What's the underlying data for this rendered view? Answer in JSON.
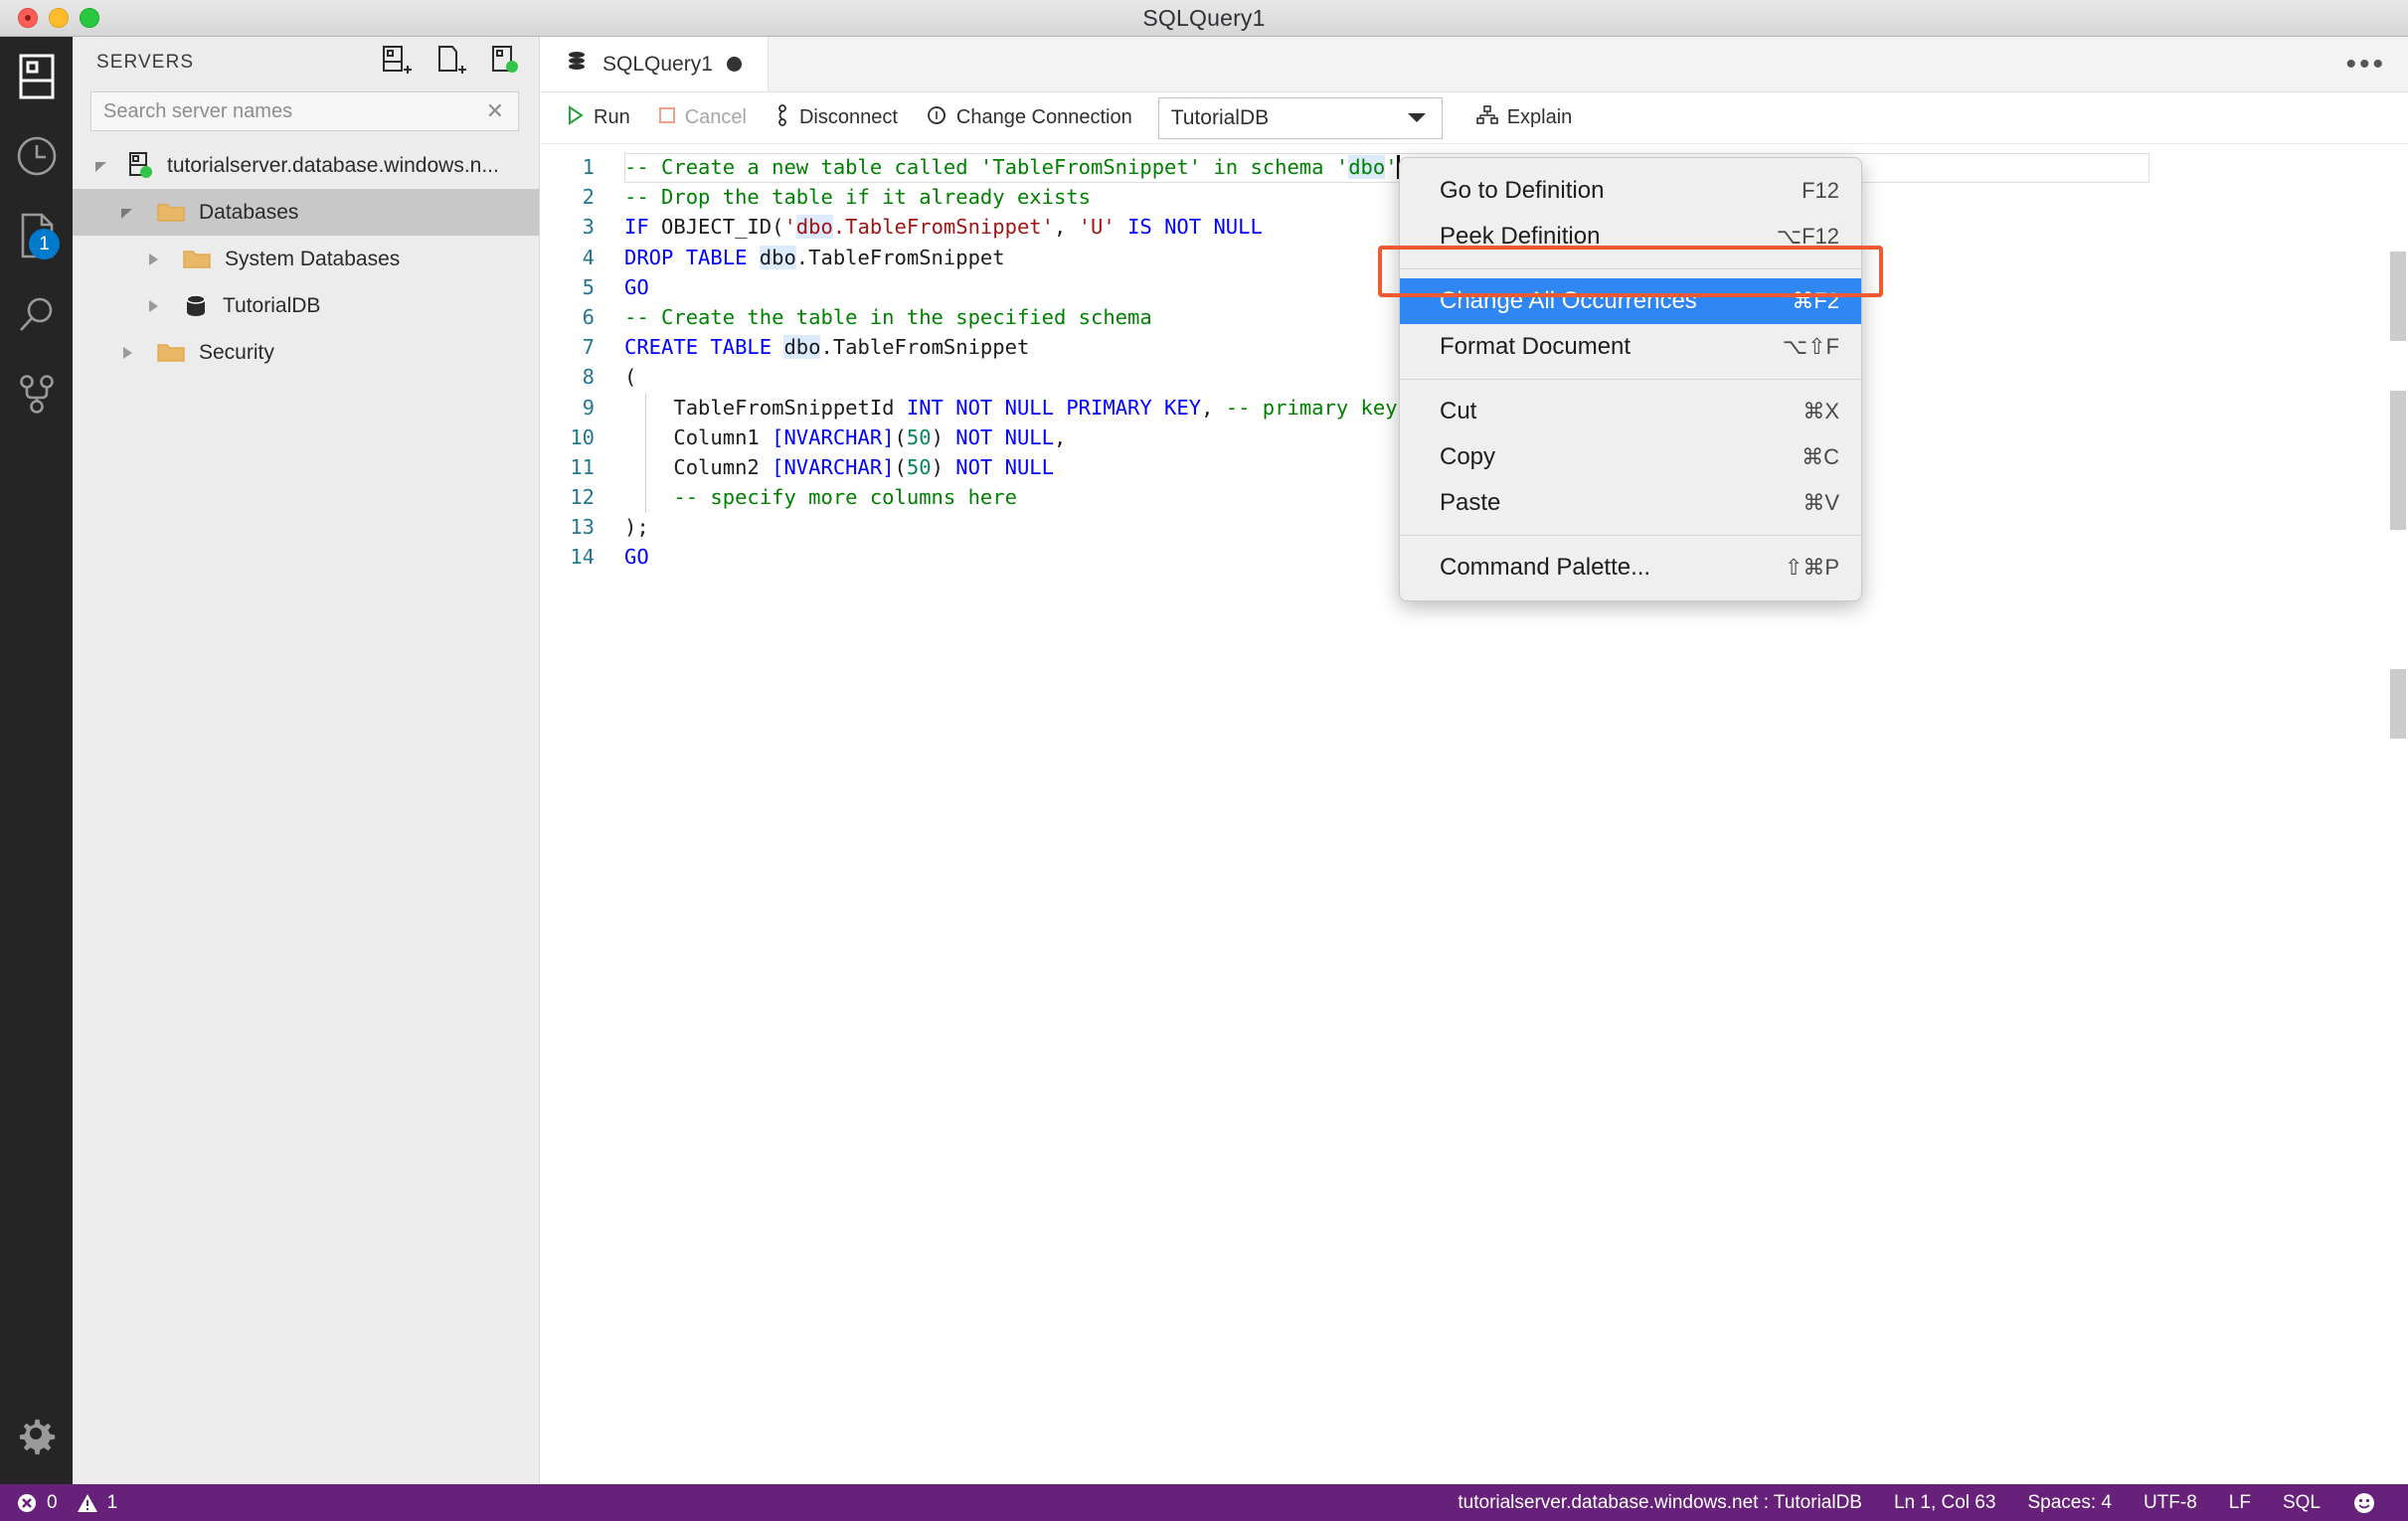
{
  "window": {
    "title": "SQLQuery1",
    "traffic_lights": [
      "close-button",
      "minimize-button",
      "zoom-button"
    ]
  },
  "activity_bar": {
    "items": [
      {
        "name": "servers-icon",
        "label": "Servers"
      },
      {
        "name": "history-icon",
        "label": "Query History"
      },
      {
        "name": "file-icon",
        "label": "Explorer",
        "badge": "1"
      },
      {
        "name": "search-icon",
        "label": "Search"
      },
      {
        "name": "source-control-icon",
        "label": "Source Control"
      }
    ],
    "bottom": {
      "name": "gear-icon",
      "label": "Manage"
    }
  },
  "sidebar": {
    "title": "SERVERS",
    "actions": [
      {
        "name": "new-connection-icon",
        "label": "New Connection"
      },
      {
        "name": "new-query-icon",
        "label": "New Query"
      },
      {
        "name": "new-server-group-icon",
        "label": "New Server Group"
      }
    ],
    "search": {
      "placeholder": "Search server names",
      "value": "",
      "clear_label": "✕"
    },
    "tree": [
      {
        "label": "tutorialserver.database.windows.n...",
        "icon": "server-icon",
        "indent": 0,
        "expanded": true,
        "selected": false
      },
      {
        "label": "Databases",
        "icon": "folder-icon",
        "indent": 1,
        "expanded": true,
        "selected": true
      },
      {
        "label": "System Databases",
        "icon": "folder-icon",
        "indent": 2,
        "expanded": false,
        "selected": false
      },
      {
        "label": "TutorialDB",
        "icon": "database-icon",
        "indent": 2,
        "expanded": false,
        "selected": false
      },
      {
        "label": "Security",
        "icon": "folder-icon",
        "indent": 1,
        "expanded": false,
        "selected": false
      }
    ]
  },
  "editor": {
    "tab": {
      "label": "SQLQuery1",
      "icon": "database-icon",
      "dirty": true
    },
    "overflow_label": "•••",
    "toolbar": {
      "run": "Run",
      "cancel": "Cancel",
      "disconnect": "Disconnect",
      "change_connection": "Change Connection",
      "database_select": "TutorialDB",
      "explain": "Explain"
    },
    "lines": [
      {
        "n": "1",
        "tokens": [
          {
            "t": "-- Create a new table called 'TableFromSnippet' in schema '",
            "c": "cmt"
          },
          {
            "t": "dbo",
            "c": "cmt hl"
          },
          {
            "t": "'",
            "c": "cmt"
          }
        ],
        "caret_after": true,
        "current": true
      },
      {
        "n": "2",
        "tokens": [
          {
            "t": "-- Drop the table if it already exists",
            "c": "cmt"
          }
        ]
      },
      {
        "n": "3",
        "tokens": [
          {
            "t": "IF",
            "c": "kw"
          },
          {
            "t": " OBJECT_ID(",
            "c": "plain"
          },
          {
            "t": "'",
            "c": "str"
          },
          {
            "t": "dbo",
            "c": "str hl"
          },
          {
            "t": ".TableFromSnippet'",
            "c": "str"
          },
          {
            "t": ", ",
            "c": "plain"
          },
          {
            "t": "'U'",
            "c": "str"
          },
          {
            "t": " ",
            "c": "plain"
          },
          {
            "t": "IS NOT NULL",
            "c": "kw"
          }
        ]
      },
      {
        "n": "4",
        "tokens": [
          {
            "t": "DROP TABLE",
            "c": "kw"
          },
          {
            "t": " ",
            "c": "plain"
          },
          {
            "t": "dbo",
            "c": "plain hl"
          },
          {
            "t": ".TableFromSnippet",
            "c": "plain"
          }
        ]
      },
      {
        "n": "5",
        "tokens": [
          {
            "t": "GO",
            "c": "kw"
          }
        ]
      },
      {
        "n": "6",
        "tokens": [
          {
            "t": "-- Create the table in the specified schema",
            "c": "cmt"
          }
        ]
      },
      {
        "n": "7",
        "tokens": [
          {
            "t": "CREATE TABLE",
            "c": "kw"
          },
          {
            "t": " ",
            "c": "plain"
          },
          {
            "t": "dbo",
            "c": "plain hl"
          },
          {
            "t": ".TableFromSnippet",
            "c": "plain"
          }
        ]
      },
      {
        "n": "8",
        "tokens": [
          {
            "t": "(",
            "c": "plain"
          }
        ]
      },
      {
        "n": "9",
        "tokens": [
          {
            "t": "    TableFromSnippetId ",
            "c": "plain"
          },
          {
            "t": "INT NOT NULL PRIMARY KEY",
            "c": "kw"
          },
          {
            "t": ",",
            "c": "plain"
          },
          {
            "t": " -- primary key column",
            "c": "cmt"
          }
        ]
      },
      {
        "n": "10",
        "tokens": [
          {
            "t": "    Column1 ",
            "c": "plain"
          },
          {
            "t": "[NVARCHAR]",
            "c": "kw"
          },
          {
            "t": "(",
            "c": "plain"
          },
          {
            "t": "50",
            "c": "num"
          },
          {
            "t": ") ",
            "c": "plain"
          },
          {
            "t": "NOT NULL",
            "c": "kw"
          },
          {
            "t": ",",
            "c": "plain"
          }
        ]
      },
      {
        "n": "11",
        "tokens": [
          {
            "t": "    Column2 ",
            "c": "plain"
          },
          {
            "t": "[NVARCHAR]",
            "c": "kw"
          },
          {
            "t": "(",
            "c": "plain"
          },
          {
            "t": "50",
            "c": "num"
          },
          {
            "t": ") ",
            "c": "plain"
          },
          {
            "t": "NOT NULL",
            "c": "kw"
          }
        ]
      },
      {
        "n": "12",
        "tokens": [
          {
            "t": "    -- specify more columns here",
            "c": "cmt"
          }
        ]
      },
      {
        "n": "13",
        "tokens": [
          {
            "t": ");",
            "c": "plain"
          }
        ]
      },
      {
        "n": "14",
        "tokens": [
          {
            "t": "GO",
            "c": "kw"
          }
        ]
      }
    ]
  },
  "context_menu": {
    "items": [
      {
        "label": "Go to Definition",
        "key": "F12",
        "active": false,
        "separator_after": false
      },
      {
        "label": "Peek Definition",
        "key": "⌥F12",
        "active": false,
        "separator_after": true
      },
      {
        "label": "Change All Occurrences",
        "key": "⌘F2",
        "active": true,
        "separator_after": false
      },
      {
        "label": "Format Document",
        "key": "⌥⇧F",
        "active": false,
        "separator_after": true
      },
      {
        "label": "Cut",
        "key": "⌘X",
        "active": false,
        "separator_after": false
      },
      {
        "label": "Copy",
        "key": "⌘C",
        "active": false,
        "separator_after": false
      },
      {
        "label": "Paste",
        "key": "⌘V",
        "active": false,
        "separator_after": true
      },
      {
        "label": "Command Palette...",
        "key": "⇧⌘P",
        "active": false,
        "separator_after": false
      }
    ],
    "highlight_color": "#f2582f",
    "active_color": "#2f86f5"
  },
  "status_bar": {
    "background": "#68217a",
    "errors": "0",
    "warnings": "1",
    "connection": "tutorialserver.database.windows.net : TutorialDB",
    "position": "Ln 1, Col 63",
    "spaces": "Spaces: 4",
    "encoding": "UTF-8",
    "eol": "LF",
    "language": "SQL",
    "feedback": "smiley-icon"
  }
}
